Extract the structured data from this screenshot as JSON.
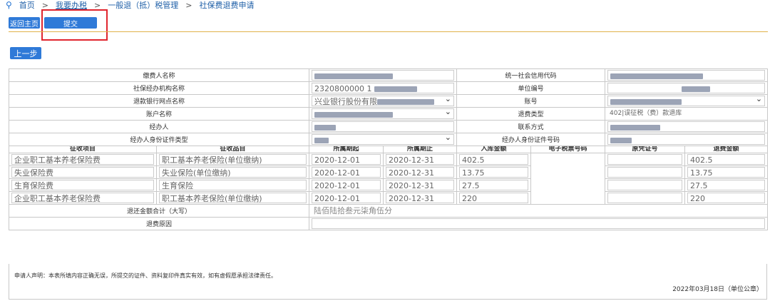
{
  "breadcrumb": {
    "items": [
      "首页",
      "我要办税",
      "一般退（抵）税管理",
      "社保费退费申请"
    ],
    "separator": ">"
  },
  "toolbar": {
    "back_home_label": "返回主页",
    "submit_label": "提交",
    "prev_step_label": "上一步"
  },
  "form": {
    "payer_name_label": "缴费人名称",
    "credit_code_label": "统一社会信用代码",
    "agency_name_label": "社保经办机构名称",
    "agency_name_value": "2320800000 1",
    "unit_no_label": "单位编号",
    "refund_bank_label": "退款银行网点名称",
    "refund_bank_value": "兴业银行股份有限",
    "account_no_label": "账号",
    "account_name_label": "账户名称",
    "refund_type_label": "退费类型",
    "refund_type_value": "402|误征税（费）款退库",
    "handler_label": "经办人",
    "contact_label": "联系方式",
    "handler_id_type_label": "经办人身份证件类型",
    "handler_id_no_label": "经办人身份证件号码"
  },
  "table": {
    "headers": [
      "征收项目",
      "征收品目",
      "所属期起",
      "所属期止",
      "入库金额",
      "电子税票号码",
      "原凭证号",
      "退费金额"
    ],
    "rows": [
      {
        "item": "企业职工基本养老保险费",
        "sub": "职工基本养老保险(单位缴纳)",
        "start": "2020-12-01",
        "end": "2020-12-31",
        "amount": "402.5",
        "refund": "402.5"
      },
      {
        "item": "失业保险费",
        "sub": "失业保险(单位缴纳)",
        "start": "2020-12-01",
        "end": "2020-12-31",
        "amount": "13.75",
        "refund": "13.75"
      },
      {
        "item": "生育保险费",
        "sub": "生育保险",
        "start": "2020-12-01",
        "end": "2020-12-31",
        "amount": "27.5",
        "refund": "27.5"
      },
      {
        "item": "企业职工基本养老保险费",
        "sub": "职工基本养老保险(单位缴纳)",
        "start": "2020-12-01",
        "end": "2020-12-31",
        "amount": "220",
        "refund": "220"
      }
    ],
    "total_label": "退还金额合计（大写）",
    "total_value": "陆佰陆拾叁元柒角伍分",
    "reason_label": "退费原因"
  },
  "declaration": "申请人声明：本表所填内容正确无误，所提交的证件、资料复印件真实有效，如有虚假愿承担法律责任。",
  "date_text": "2022年03月18日（单位公章）",
  "colors": {
    "accent": "#2f7ad8",
    "highlight": "#e0252e",
    "divider": "#e1b24a"
  }
}
